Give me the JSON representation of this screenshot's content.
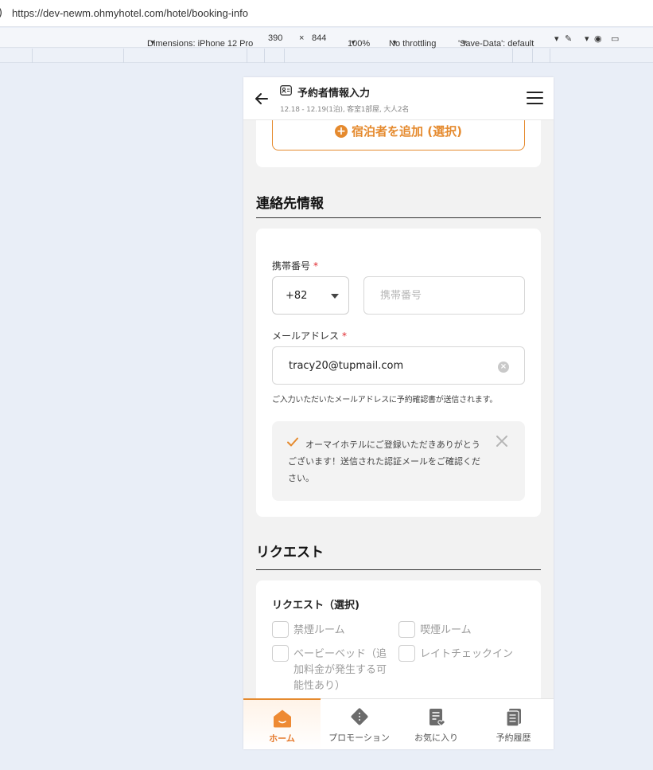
{
  "browser": {
    "left_cut": ")",
    "url": "https://dev-newm.ohmyhotel.com/hotel/booking-info"
  },
  "devtools": {
    "dimensions_label": "Dimensions: iPhone 12 Pro",
    "width": "390",
    "times": "×",
    "height": "844",
    "zoom": "100%",
    "throttle": "No throttling",
    "save_data": "'Save-Data': default"
  },
  "header": {
    "title": "予約者情報入力",
    "subtitle": "12.18 - 12.19(1泊), 客室1部屋, 大人2名"
  },
  "add_guest": {
    "label": "宿泊者を追加 (選択)"
  },
  "contact": {
    "section_title": "連絡先情報",
    "phone_label": "携帯番号",
    "required_mark": "*",
    "country_code": "+82",
    "phone_placeholder": "携帯番号",
    "email_label": "メールアドレス",
    "email_value": "tracy20@tupmail.com",
    "help_text": "ご入力いただいたメールアドレスに予約確認書が送信されます。",
    "notice": "オーマイホテルにご登録いただきありがとうございます！送信された認証メールをご確認ください。"
  },
  "request": {
    "section_title": "リクエスト",
    "card_title": "リクエスト（選択)",
    "options": [
      "禁煙ルーム",
      "喫煙ルーム",
      "ベービーベッド（追加料金が発生する可能性あり）",
      "レイトチェックイン"
    ]
  },
  "nav": {
    "items": [
      "ホーム",
      "プロモーション",
      "お気に入り",
      "予約履歴"
    ]
  },
  "colors": {
    "accent": "#e58a2e",
    "required": "#e0282e"
  }
}
